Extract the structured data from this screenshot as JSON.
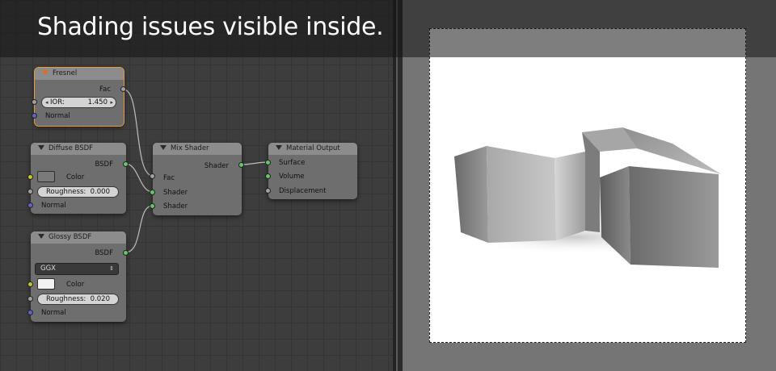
{
  "caption": "Shading issues visible inside.",
  "nodes": {
    "fresnel": {
      "title": "Fresnel",
      "output": "Fac",
      "ior_label": "IOR:",
      "ior_value": "1.450",
      "normal": "Normal"
    },
    "diffuse": {
      "title": "Diffuse BSDF",
      "output": "BSDF",
      "color": "Color",
      "roughness_label": "Roughness:",
      "roughness_value": "0.000",
      "normal": "Normal",
      "swatch_color": "#7a7a7a"
    },
    "glossy": {
      "title": "Glossy BSDF",
      "output": "BSDF",
      "distribution": "GGX",
      "color": "Color",
      "roughness_label": "Roughness:",
      "roughness_value": "0.020",
      "normal": "Normal",
      "swatch_color": "#f2f2f2"
    },
    "mix": {
      "title": "Mix Shader",
      "output": "Shader",
      "fac": "Fac",
      "shader1": "Shader",
      "shader2": "Shader"
    },
    "output": {
      "title": "Material Output",
      "surface": "Surface",
      "volume": "Volume",
      "displacement": "Displacement"
    }
  },
  "colors": {
    "socket_shader": "#63c763",
    "socket_float": "#a1a1a1",
    "socket_color": "#c7c729",
    "socket_vector": "#6363c7",
    "active_outline": "#e79a3c"
  }
}
